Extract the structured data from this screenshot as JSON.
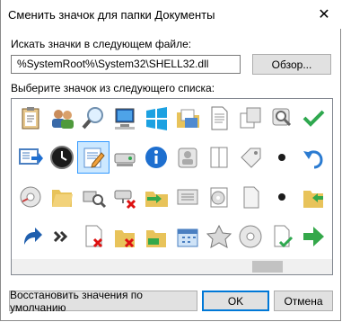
{
  "window": {
    "title": "Сменить значок для папки Документы",
    "close_glyph": "✕"
  },
  "file_label": "Искать значки в следующем файле:",
  "file_path": "%SystemRoot%\\System32\\SHELL32.dll",
  "browse_button": "Обзор...",
  "list_label": "Выберите значок из следующего списка:",
  "icons": [
    "clipboard-icon",
    "users-icon",
    "magnifier-icon",
    "computer-icon",
    "windows-flag-icon",
    "folder-docs-icon",
    "document-icon",
    "windows-overlap-icon",
    "search-folder-icon",
    "checkmark-icon",
    "monitor-arrow-icon",
    "clock-icon",
    "notepad-edit-icon",
    "drive-icon",
    "info-icon",
    "user-files-icon",
    "pages-icon",
    "tag-icon",
    "dot-icon",
    "undo-arrow-icon",
    "disc-drive-icon",
    "folder-open-icon",
    "printer-search-icon",
    "drive-disconnected-icon",
    "folder-green-arrow-icon",
    "list-window-icon",
    "cd-document-icon",
    "blank-page-icon",
    "dot-icon",
    "folder-arrow-icon",
    "shortcut-arrow-icon",
    "double-chevron-icon",
    "document-x-icon",
    "folder-x-icon",
    "folder-green-icon",
    "calendar-icon",
    "star-icon",
    "disc-icon",
    "page-check-icon",
    "green-arrow-icon"
  ],
  "selected_icon_index": 12,
  "restore_button": "Восстановить значения по умолчанию",
  "ok_button": "OK",
  "cancel_button": "Отмена",
  "colors": {
    "accent": "#0078d7",
    "selection_bg": "#cce8ff",
    "button_bg": "#e1e1e1"
  }
}
